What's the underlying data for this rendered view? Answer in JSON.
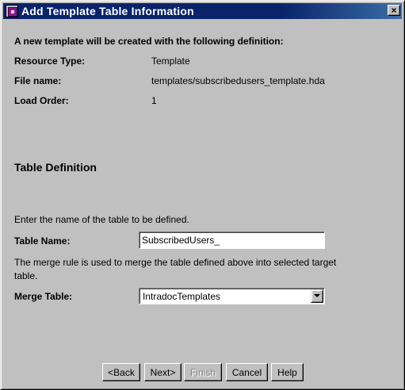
{
  "window": {
    "title": "Add Template Table Information",
    "close_label": "×",
    "app_icon": "app-icon",
    "close_icon": "close-icon"
  },
  "summary": {
    "intro": "A new template will be created with the following definition:",
    "resource_type_label": "Resource Type:",
    "resource_type_value": "Template",
    "file_name_label": "File name:",
    "file_name_value": "templates/subscribedusers_template.hda",
    "load_order_label": "Load Order:",
    "load_order_value": "1"
  },
  "table_definition": {
    "heading": "Table Definition",
    "instruction": "Enter the name of the table to be defined.",
    "table_name_label": "Table Name:",
    "table_name_value": "SubscribedUsers_",
    "merge_rule_line1": "The merge rule is used to merge the table defined above into selected target",
    "merge_rule_line2": "table.",
    "merge_table_label": "Merge Table:",
    "merge_table_value": "IntradocTemplates"
  },
  "buttons": {
    "back": "<Back",
    "next": "Next>",
    "finish": "Finish",
    "cancel": "Cancel",
    "help": "Help"
  }
}
